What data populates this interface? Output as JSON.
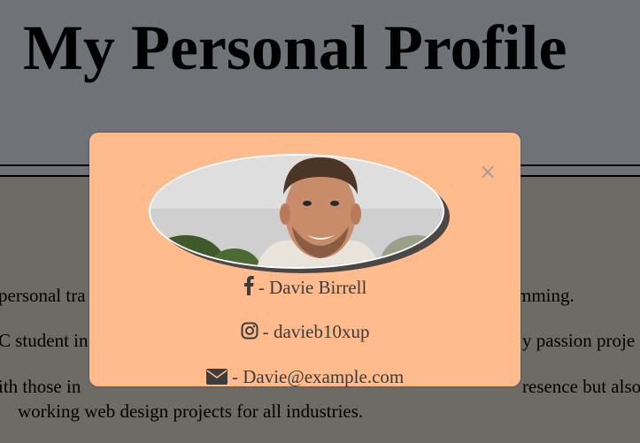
{
  "header": {
    "title": "My Personal Profile"
  },
  "background_text": {
    "line1_left": "personal tra",
    "line1_right": "mming.",
    "line2_left": "C student in",
    "line2_right": "y passion proje",
    "line3_left": "ith those in",
    "line3_right": "resence but also",
    "line4": "working web design projects for all industries."
  },
  "modal": {
    "close_label": "×",
    "contacts": [
      {
        "icon": "facebook-icon",
        "text": " - Davie Birrell"
      },
      {
        "icon": "instagram-icon",
        "text": " - davieb10xup"
      },
      {
        "icon": "envelope-icon",
        "text": " - Davie@example.com"
      }
    ]
  },
  "colors": {
    "modal_bg": "#ffbb8c",
    "header_bg": "#6f7378",
    "body_bg": "#6e6a66",
    "text": "#3c3c3c"
  }
}
